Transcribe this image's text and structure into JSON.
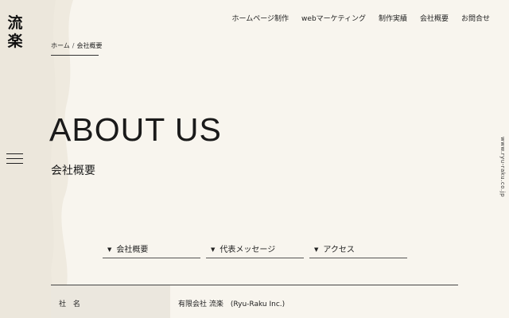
{
  "logo": {
    "line1": "流",
    "line2": "楽"
  },
  "nav": {
    "items": [
      "ホームページ制作",
      "webマーケティング",
      "制作実績",
      "会社概要",
      "お問合せ"
    ]
  },
  "breadcrumb": {
    "home": "ホーム",
    "separator": "/",
    "current": "会社概要"
  },
  "hero": {
    "title": "ABOUT US",
    "subtitle": "会社概要"
  },
  "side_url": "www.ryu-raku.co.jp",
  "anchors": [
    {
      "label": "会社概要"
    },
    {
      "label": "代表メッセージ"
    },
    {
      "label": "アクセス"
    }
  ],
  "company_table": {
    "rows": [
      {
        "label": "社 名",
        "value": "有限会社 流楽　(Ryu-Raku Inc.)"
      }
    ]
  },
  "colors": {
    "background": "#f8f5ee",
    "brush": "#efeadf",
    "text": "#222222",
    "label_bg": "#ebe7de"
  },
  "icons": {
    "menu": "hamburger-icon",
    "anchor": "triangle-down-icon"
  }
}
